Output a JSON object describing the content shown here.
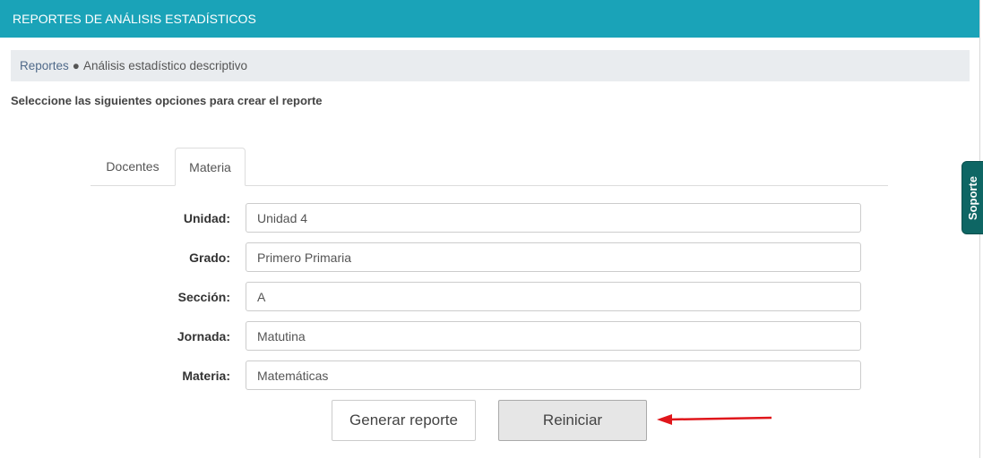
{
  "header": {
    "title": "REPORTES DE ANÁLISIS ESTADÍSTICOS"
  },
  "breadcrumb": {
    "link": "Reportes",
    "separator": "●",
    "current": "Análisis estadístico descriptivo"
  },
  "instruction": "Seleccione las siguientes opciones para crear el reporte",
  "tabs": [
    {
      "label": "Docentes",
      "active": false
    },
    {
      "label": "Materia",
      "active": true
    }
  ],
  "form": {
    "fields": [
      {
        "label": "Unidad:",
        "value": "Unidad 4"
      },
      {
        "label": "Grado:",
        "value": "Primero Primaria"
      },
      {
        "label": "Sección:",
        "value": "A"
      },
      {
        "label": "Jornada:",
        "value": "Matutina"
      },
      {
        "label": "Materia:",
        "value": "Matemáticas"
      }
    ]
  },
  "buttons": {
    "generate": "Generar reporte",
    "reset": "Reiniciar"
  },
  "support": {
    "label": "Soporte"
  },
  "colors": {
    "header": "#1aa3b8",
    "support": "#0e6664",
    "arrow": "#e0161b"
  }
}
